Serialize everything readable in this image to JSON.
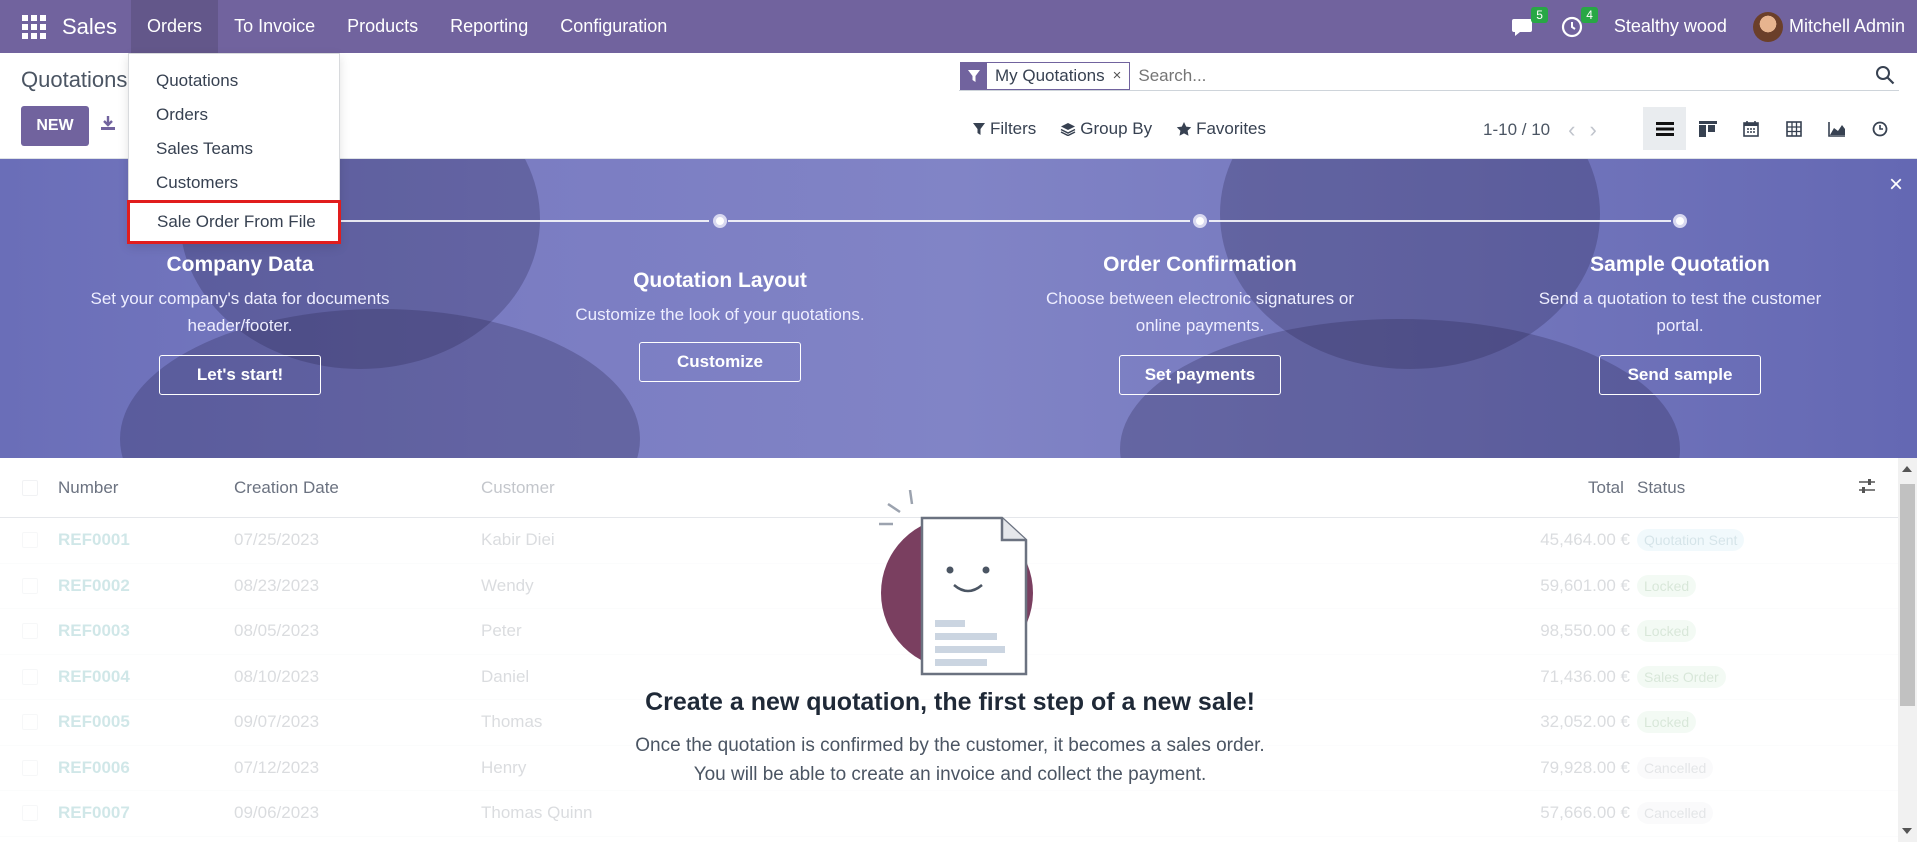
{
  "navbar": {
    "app_name": "Sales",
    "menus": [
      "Orders",
      "To Invoice",
      "Products",
      "Reporting",
      "Configuration"
    ],
    "messages_badge": "5",
    "activities_badge": "4",
    "company": "Stealthy wood",
    "user": "Mitchell Admin"
  },
  "control_panel": {
    "title": "Quotations",
    "new_label": "NEW",
    "facet_label": "My Quotations",
    "facet_close": "×",
    "search_placeholder": "Search...",
    "filters_label": "Filters",
    "group_by_label": "Group By",
    "favorites_label": "Favorites",
    "pager": "1-10 / 10",
    "views": [
      "list",
      "kanban",
      "calendar",
      "pivot",
      "graph",
      "activity"
    ]
  },
  "orders_menu": {
    "items": [
      "Quotations",
      "Orders",
      "Sales Teams",
      "Customers",
      "Sale Order From File"
    ],
    "highlighted": "Sale Order From File"
  },
  "banner": {
    "close": "×",
    "steps": [
      {
        "title": "Company Data",
        "desc_line1": "Set your company's data for documents",
        "desc_line2": "header/footer.",
        "button": "Let's start!"
      },
      {
        "title": "Quotation Layout",
        "desc_line1": "Customize the look of your quotations.",
        "desc_line2": "",
        "button": "Customize"
      },
      {
        "title": "Order Confirmation",
        "desc_line1": "Choose between electronic signatures or",
        "desc_line2": "online payments.",
        "button": "Set payments"
      },
      {
        "title": "Sample Quotation",
        "desc_line1": "Send a quotation to test the customer",
        "desc_line2": "portal.",
        "button": "Send sample"
      }
    ]
  },
  "list": {
    "headers": {
      "number": "Number",
      "creation_date": "Creation Date",
      "customer": "Customer",
      "total": "Total",
      "status": "Status"
    },
    "rows": [
      {
        "number": "REF0001",
        "date": "07/25/2023",
        "customer": "Kabir Diei",
        "total": "45,464.00 €",
        "status": "Quotation Sent",
        "tone": "blue"
      },
      {
        "number": "REF0002",
        "date": "08/23/2023",
        "customer": "Wendy",
        "total": "59,601.00 €",
        "status": "Locked",
        "tone": "green"
      },
      {
        "number": "REF0003",
        "date": "08/05/2023",
        "customer": "Peter",
        "total": "98,550.00 €",
        "status": "Locked",
        "tone": "green"
      },
      {
        "number": "REF0004",
        "date": "08/10/2023",
        "customer": "Daniel",
        "total": "71,436.00 €",
        "status": "Sales Order",
        "tone": "green"
      },
      {
        "number": "REF0005",
        "date": "09/07/2023",
        "customer": "Thomas",
        "total": "32,052.00 €",
        "status": "Locked",
        "tone": "green"
      },
      {
        "number": "REF0006",
        "date": "07/12/2023",
        "customer": "Henry",
        "total": "79,928.00 €",
        "status": "Cancelled",
        "tone": "gray"
      },
      {
        "number": "REF0007",
        "date": "09/06/2023",
        "customer": "Thomas Quinn",
        "total": "57,666.00 €",
        "status": "Cancelled",
        "tone": "gray"
      }
    ]
  },
  "helper": {
    "title": "Create a new quotation, the first step of a new sale!",
    "line1": "Once the quotation is confirmed by the customer, it becomes a sales order.",
    "line2": "You will be able to create an invoice and collect the payment."
  },
  "colors": {
    "brand": "#71639e",
    "highlight_border": "#e11d1d",
    "badge": "#28a745"
  }
}
